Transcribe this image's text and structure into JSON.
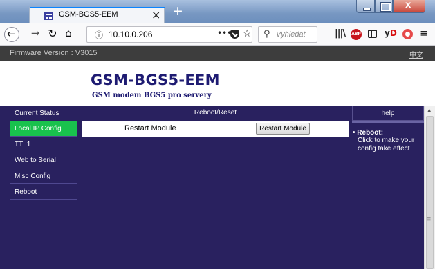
{
  "browser": {
    "tab_title": "GSM-BGS5-EEM",
    "tab_close": "×",
    "new_tab": "+",
    "url": "10.10.0.206",
    "url_more": "•••",
    "search_placeholder": "Vyhledat",
    "close_glyph": "x"
  },
  "page": {
    "firmware": "Firmware Version : V3015",
    "lang_link": "中文",
    "title": "GSM-BGS5-EEM",
    "subtitle": "GSM modem BGS5 pro servery"
  },
  "sidebar": {
    "items": [
      {
        "label": "Current Status",
        "active": false
      },
      {
        "label": "Local IP Config",
        "active": true
      },
      {
        "label": "TTL1",
        "active": false
      },
      {
        "label": "Web to Serial",
        "active": false
      },
      {
        "label": "Misc Config",
        "active": false
      },
      {
        "label": "Reboot",
        "active": false
      }
    ]
  },
  "content": {
    "header": "Reboot/Reset",
    "row_label": "Restart Module",
    "button_label": "Restart Module"
  },
  "help": {
    "header": "help",
    "title": "• Reboot:",
    "text": "Click to make your config take effect"
  },
  "colors": {
    "nav_bg": "#29215f",
    "active_item": "#19c24d",
    "brand": "#1e1b72",
    "firmware_bar": "#3d3d3d"
  }
}
